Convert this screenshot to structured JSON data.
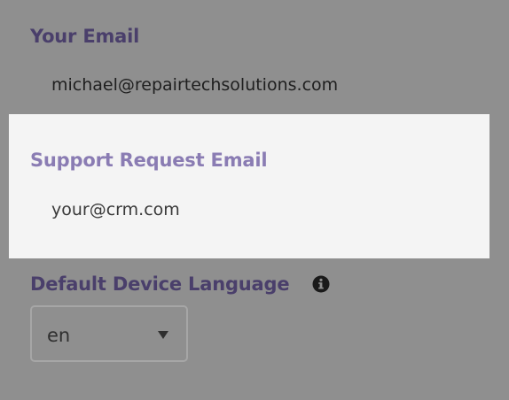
{
  "your_email": {
    "label": "Your Email",
    "value": "michael@repairtechsolutions.com"
  },
  "support_email": {
    "label": "Support Request Email",
    "placeholder": "your@crm.com"
  },
  "device_language": {
    "label": "Default Device Language",
    "selected": "en",
    "info_icon": "info-circle-icon",
    "dropdown_icon": "chevron-down-icon"
  },
  "colors": {
    "background": "#8f8f8f",
    "panel": "#f4f4f4",
    "label": "#4a3f6b",
    "label_highlighted": "#8a7cb3"
  }
}
